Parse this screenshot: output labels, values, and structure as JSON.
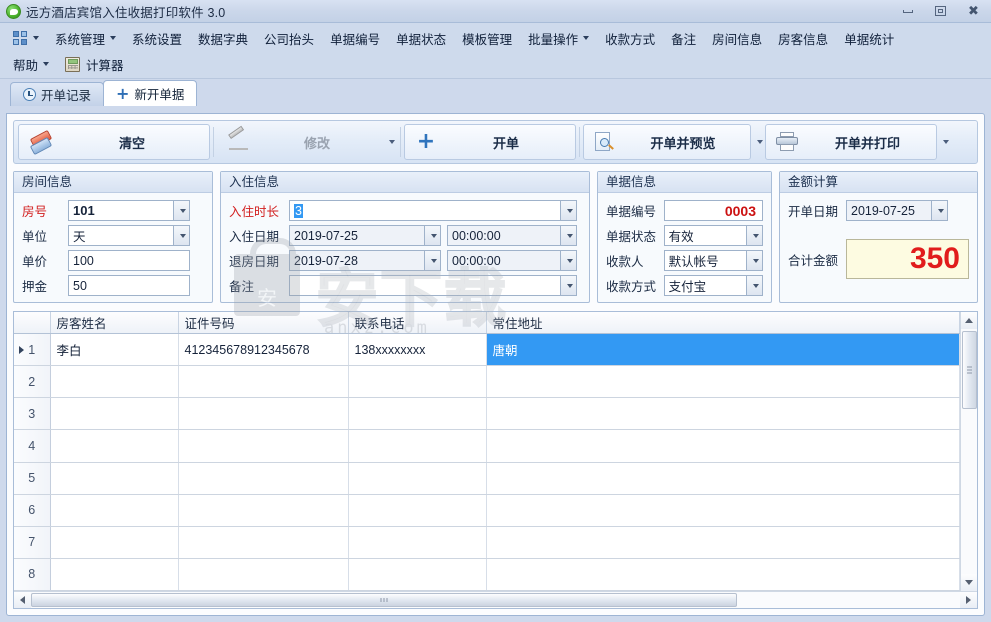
{
  "window": {
    "title": "远方酒店宾馆入住收据打印软件 3.0",
    "app_icon": "green-circle-icon",
    "minimize": "minimize-icon",
    "maximize": "maximize-icon",
    "close": "close-icon"
  },
  "menu": {
    "row1": [
      {
        "label": "",
        "icon": "grid-icon",
        "caret": true
      },
      {
        "label": "系统管理",
        "caret": true
      },
      {
        "label": "系统设置",
        "caret": false
      },
      {
        "label": "数据字典",
        "caret": false
      },
      {
        "label": "公司抬头",
        "caret": false
      },
      {
        "label": "单据编号",
        "caret": false
      },
      {
        "label": "单据状态",
        "caret": false
      },
      {
        "label": "模板管理",
        "caret": false
      },
      {
        "label": "批量操作",
        "caret": true
      },
      {
        "label": "收款方式",
        "caret": false
      },
      {
        "label": "备注",
        "caret": false
      },
      {
        "label": "房间信息",
        "caret": false
      },
      {
        "label": "房客信息",
        "caret": false
      },
      {
        "label": "单据统计",
        "caret": false
      }
    ],
    "row2": [
      {
        "label": "帮助",
        "caret": true
      },
      {
        "label": "计算器",
        "icon": "calculator-icon",
        "caret": false
      }
    ]
  },
  "tabs": [
    {
      "label": "开单记录",
      "icon": "clock-icon",
      "active": false
    },
    {
      "label": "新开单据",
      "icon": "plus-icon",
      "active": true
    }
  ],
  "toolbar": {
    "clear_label": "清空",
    "modify_label": "修改",
    "create_label": "开单",
    "create_preview_label": "开单并预览",
    "create_print_label": "开单并打印"
  },
  "room_info": {
    "title": "房间信息",
    "room_no_label": "房号",
    "room_no_value": "101",
    "unit_label": "单位",
    "unit_value": "天",
    "price_label": "单价",
    "price_value": "100",
    "deposit_label": "押金",
    "deposit_value": "50"
  },
  "stay_info": {
    "title": "入住信息",
    "duration_label": "入住时长",
    "duration_value": "3",
    "checkin_date_label": "入住日期",
    "checkin_date_value": "2019-07-25",
    "checkin_time_value": "00:00:00",
    "checkout_date_label": "退房日期",
    "checkout_date_value": "2019-07-28",
    "checkout_time_value": "00:00:00",
    "remark_label": "备注",
    "remark_value": ""
  },
  "doc_info": {
    "title": "单据信息",
    "doc_no_label": "单据编号",
    "doc_no_value": "0003",
    "doc_status_label": "单据状态",
    "doc_status_value": "有效",
    "payee_label": "收款人",
    "payee_value": "默认帐号",
    "pay_method_label": "收款方式",
    "pay_method_value": "支付宝"
  },
  "amount_calc": {
    "title": "金额计算",
    "bill_date_label": "开单日期",
    "bill_date_value": "2019-07-25",
    "total_label": "合计金额",
    "total_value": "350",
    "total_color": "#e11c1c",
    "total_bg": "#fdfbe1"
  },
  "guest_table": {
    "columns": [
      "",
      "房客姓名",
      "证件号码",
      "联系电话",
      "常住地址"
    ],
    "rows": [
      {
        "no": "1",
        "name": "李白",
        "id_no": "412345678912345678",
        "phone": "138xxxxxxxx",
        "address": "唐朝",
        "selected": true
      },
      {
        "no": "2",
        "name": "",
        "id_no": "",
        "phone": "",
        "address": "",
        "selected": false
      },
      {
        "no": "3",
        "name": "",
        "id_no": "",
        "phone": "",
        "address": "",
        "selected": false
      },
      {
        "no": "4",
        "name": "",
        "id_no": "",
        "phone": "",
        "address": "",
        "selected": false
      },
      {
        "no": "5",
        "name": "",
        "id_no": "",
        "phone": "",
        "address": "",
        "selected": false
      },
      {
        "no": "6",
        "name": "",
        "id_no": "",
        "phone": "",
        "address": "",
        "selected": false
      },
      {
        "no": "7",
        "name": "",
        "id_no": "",
        "phone": "",
        "address": "",
        "selected": false
      },
      {
        "no": "8",
        "name": "",
        "id_no": "",
        "phone": "",
        "address": "",
        "selected": false
      }
    ]
  },
  "watermark": {
    "text": "安下载",
    "sub": "anxz.com"
  },
  "theme": {
    "background": "#ced9ec",
    "panel_border": "#a9bdd8",
    "required_label": "#d21f1f",
    "selection": "#3399f3"
  }
}
